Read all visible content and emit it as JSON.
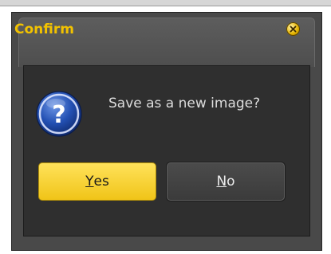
{
  "dialog": {
    "title": "Confirm",
    "message": "Save as a new image?",
    "icon": "question-icon",
    "close_icon": "close-icon"
  },
  "buttons": {
    "yes": {
      "mnemonic": "Y",
      "rest": "es"
    },
    "no": {
      "mnemonic": "N",
      "rest": "o"
    }
  },
  "colors": {
    "accent": "#f2c200",
    "yes_button": "#f5cf2c",
    "dialog_bg": "#494949",
    "content_bg": "#2f2f2f",
    "question_icon": "#1f4fb0"
  }
}
